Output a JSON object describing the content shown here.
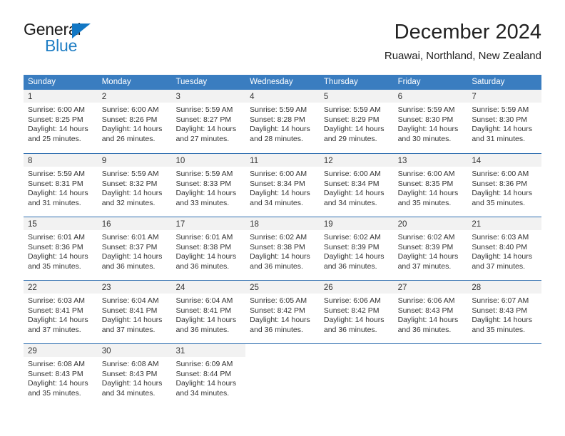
{
  "brand": {
    "name_top": "General",
    "name_bottom": "Blue",
    "triangle_color": "#1277c4",
    "blue_color": "#1f7ec4"
  },
  "header": {
    "title": "December 2024",
    "subtitle": "Ruawai, Northland, New Zealand"
  },
  "theme": {
    "header_blue": "#3a7dc0",
    "row_divider_blue": "#2f6fb0",
    "day_band_gray": "#f2f2f2",
    "text_color": "#333333"
  },
  "weekdays": [
    "Sunday",
    "Monday",
    "Tuesday",
    "Wednesday",
    "Thursday",
    "Friday",
    "Saturday"
  ],
  "weeks": [
    [
      {
        "day": "1",
        "sunrise": "Sunrise: 6:00 AM",
        "sunset": "Sunset: 8:25 PM",
        "daylight1": "Daylight: 14 hours",
        "daylight2": "and 25 minutes."
      },
      {
        "day": "2",
        "sunrise": "Sunrise: 6:00 AM",
        "sunset": "Sunset: 8:26 PM",
        "daylight1": "Daylight: 14 hours",
        "daylight2": "and 26 minutes."
      },
      {
        "day": "3",
        "sunrise": "Sunrise: 5:59 AM",
        "sunset": "Sunset: 8:27 PM",
        "daylight1": "Daylight: 14 hours",
        "daylight2": "and 27 minutes."
      },
      {
        "day": "4",
        "sunrise": "Sunrise: 5:59 AM",
        "sunset": "Sunset: 8:28 PM",
        "daylight1": "Daylight: 14 hours",
        "daylight2": "and 28 minutes."
      },
      {
        "day": "5",
        "sunrise": "Sunrise: 5:59 AM",
        "sunset": "Sunset: 8:29 PM",
        "daylight1": "Daylight: 14 hours",
        "daylight2": "and 29 minutes."
      },
      {
        "day": "6",
        "sunrise": "Sunrise: 5:59 AM",
        "sunset": "Sunset: 8:30 PM",
        "daylight1": "Daylight: 14 hours",
        "daylight2": "and 30 minutes."
      },
      {
        "day": "7",
        "sunrise": "Sunrise: 5:59 AM",
        "sunset": "Sunset: 8:30 PM",
        "daylight1": "Daylight: 14 hours",
        "daylight2": "and 31 minutes."
      }
    ],
    [
      {
        "day": "8",
        "sunrise": "Sunrise: 5:59 AM",
        "sunset": "Sunset: 8:31 PM",
        "daylight1": "Daylight: 14 hours",
        "daylight2": "and 31 minutes."
      },
      {
        "day": "9",
        "sunrise": "Sunrise: 5:59 AM",
        "sunset": "Sunset: 8:32 PM",
        "daylight1": "Daylight: 14 hours",
        "daylight2": "and 32 minutes."
      },
      {
        "day": "10",
        "sunrise": "Sunrise: 5:59 AM",
        "sunset": "Sunset: 8:33 PM",
        "daylight1": "Daylight: 14 hours",
        "daylight2": "and 33 minutes."
      },
      {
        "day": "11",
        "sunrise": "Sunrise: 6:00 AM",
        "sunset": "Sunset: 8:34 PM",
        "daylight1": "Daylight: 14 hours",
        "daylight2": "and 34 minutes."
      },
      {
        "day": "12",
        "sunrise": "Sunrise: 6:00 AM",
        "sunset": "Sunset: 8:34 PM",
        "daylight1": "Daylight: 14 hours",
        "daylight2": "and 34 minutes."
      },
      {
        "day": "13",
        "sunrise": "Sunrise: 6:00 AM",
        "sunset": "Sunset: 8:35 PM",
        "daylight1": "Daylight: 14 hours",
        "daylight2": "and 35 minutes."
      },
      {
        "day": "14",
        "sunrise": "Sunrise: 6:00 AM",
        "sunset": "Sunset: 8:36 PM",
        "daylight1": "Daylight: 14 hours",
        "daylight2": "and 35 minutes."
      }
    ],
    [
      {
        "day": "15",
        "sunrise": "Sunrise: 6:01 AM",
        "sunset": "Sunset: 8:36 PM",
        "daylight1": "Daylight: 14 hours",
        "daylight2": "and 35 minutes."
      },
      {
        "day": "16",
        "sunrise": "Sunrise: 6:01 AM",
        "sunset": "Sunset: 8:37 PM",
        "daylight1": "Daylight: 14 hours",
        "daylight2": "and 36 minutes."
      },
      {
        "day": "17",
        "sunrise": "Sunrise: 6:01 AM",
        "sunset": "Sunset: 8:38 PM",
        "daylight1": "Daylight: 14 hours",
        "daylight2": "and 36 minutes."
      },
      {
        "day": "18",
        "sunrise": "Sunrise: 6:02 AM",
        "sunset": "Sunset: 8:38 PM",
        "daylight1": "Daylight: 14 hours",
        "daylight2": "and 36 minutes."
      },
      {
        "day": "19",
        "sunrise": "Sunrise: 6:02 AM",
        "sunset": "Sunset: 8:39 PM",
        "daylight1": "Daylight: 14 hours",
        "daylight2": "and 36 minutes."
      },
      {
        "day": "20",
        "sunrise": "Sunrise: 6:02 AM",
        "sunset": "Sunset: 8:39 PM",
        "daylight1": "Daylight: 14 hours",
        "daylight2": "and 37 minutes."
      },
      {
        "day": "21",
        "sunrise": "Sunrise: 6:03 AM",
        "sunset": "Sunset: 8:40 PM",
        "daylight1": "Daylight: 14 hours",
        "daylight2": "and 37 minutes."
      }
    ],
    [
      {
        "day": "22",
        "sunrise": "Sunrise: 6:03 AM",
        "sunset": "Sunset: 8:41 PM",
        "daylight1": "Daylight: 14 hours",
        "daylight2": "and 37 minutes."
      },
      {
        "day": "23",
        "sunrise": "Sunrise: 6:04 AM",
        "sunset": "Sunset: 8:41 PM",
        "daylight1": "Daylight: 14 hours",
        "daylight2": "and 37 minutes."
      },
      {
        "day": "24",
        "sunrise": "Sunrise: 6:04 AM",
        "sunset": "Sunset: 8:41 PM",
        "daylight1": "Daylight: 14 hours",
        "daylight2": "and 36 minutes."
      },
      {
        "day": "25",
        "sunrise": "Sunrise: 6:05 AM",
        "sunset": "Sunset: 8:42 PM",
        "daylight1": "Daylight: 14 hours",
        "daylight2": "and 36 minutes."
      },
      {
        "day": "26",
        "sunrise": "Sunrise: 6:06 AM",
        "sunset": "Sunset: 8:42 PM",
        "daylight1": "Daylight: 14 hours",
        "daylight2": "and 36 minutes."
      },
      {
        "day": "27",
        "sunrise": "Sunrise: 6:06 AM",
        "sunset": "Sunset: 8:43 PM",
        "daylight1": "Daylight: 14 hours",
        "daylight2": "and 36 minutes."
      },
      {
        "day": "28",
        "sunrise": "Sunrise: 6:07 AM",
        "sunset": "Sunset: 8:43 PM",
        "daylight1": "Daylight: 14 hours",
        "daylight2": "and 35 minutes."
      }
    ],
    [
      {
        "day": "29",
        "sunrise": "Sunrise: 6:08 AM",
        "sunset": "Sunset: 8:43 PM",
        "daylight1": "Daylight: 14 hours",
        "daylight2": "and 35 minutes."
      },
      {
        "day": "30",
        "sunrise": "Sunrise: 6:08 AM",
        "sunset": "Sunset: 8:43 PM",
        "daylight1": "Daylight: 14 hours",
        "daylight2": "and 34 minutes."
      },
      {
        "day": "31",
        "sunrise": "Sunrise: 6:09 AM",
        "sunset": "Sunset: 8:44 PM",
        "daylight1": "Daylight: 14 hours",
        "daylight2": "and 34 minutes."
      },
      {
        "day": "",
        "sunrise": "",
        "sunset": "",
        "daylight1": "",
        "daylight2": ""
      },
      {
        "day": "",
        "sunrise": "",
        "sunset": "",
        "daylight1": "",
        "daylight2": ""
      },
      {
        "day": "",
        "sunrise": "",
        "sunset": "",
        "daylight1": "",
        "daylight2": ""
      },
      {
        "day": "",
        "sunrise": "",
        "sunset": "",
        "daylight1": "",
        "daylight2": ""
      }
    ]
  ]
}
